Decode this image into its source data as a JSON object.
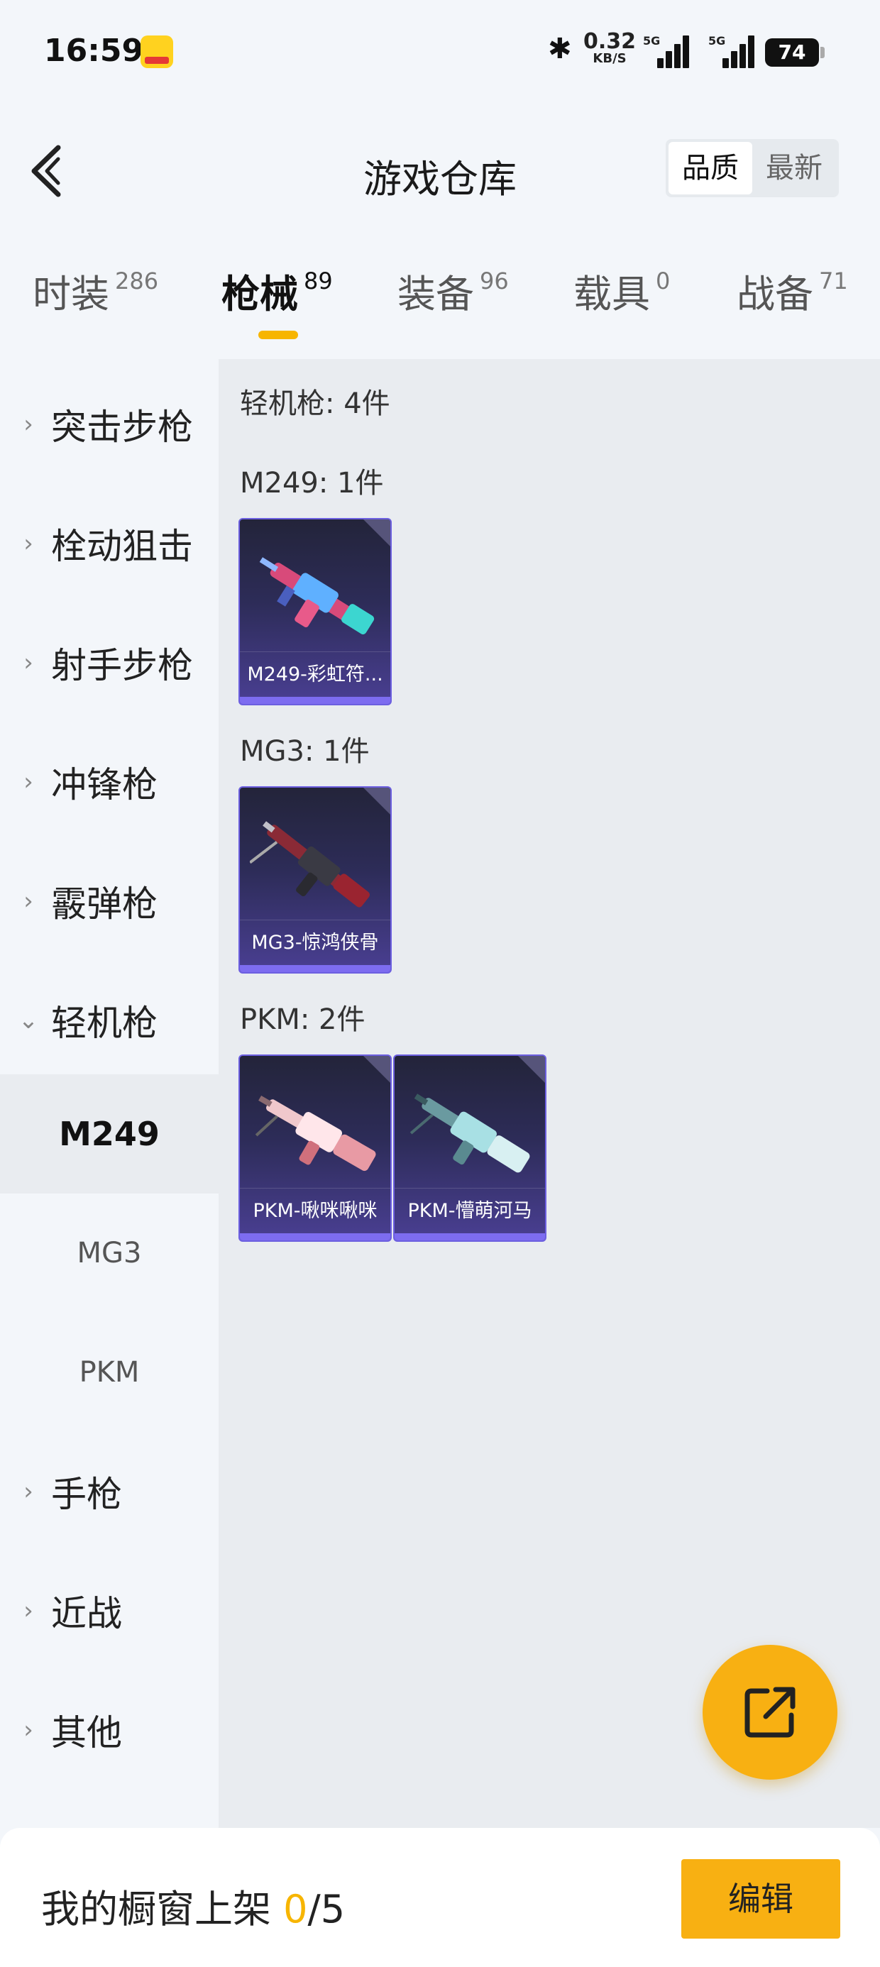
{
  "status_bar": {
    "time": "16:59",
    "net_speed_value": "0.32",
    "net_speed_unit": "KB/S",
    "signal1_label": "5G",
    "signal2_label": "5G",
    "battery": "74"
  },
  "header": {
    "title": "游戏仓库",
    "sort_options": [
      "品质",
      "最新"
    ],
    "active_sort": "品质"
  },
  "tabs": [
    {
      "label": "时装",
      "count": "286"
    },
    {
      "label": "枪械",
      "count": "89"
    },
    {
      "label": "装备",
      "count": "96"
    },
    {
      "label": "载具",
      "count": "0"
    },
    {
      "label": "战备",
      "count": "71"
    }
  ],
  "active_tab": "枪械",
  "sidebar": {
    "categories": [
      {
        "label": "突击步枪",
        "chevron": "›"
      },
      {
        "label": "栓动狙击",
        "chevron": "›"
      },
      {
        "label": "射手步枪",
        "chevron": "›"
      },
      {
        "label": "冲锋枪",
        "chevron": "›"
      },
      {
        "label": "霰弹枪",
        "chevron": "›"
      },
      {
        "label": "轻机枪",
        "chevron": "⌄"
      }
    ],
    "subitems": [
      "M249",
      "MG3",
      "PKM"
    ],
    "active_subitem": "M249",
    "more_categories": [
      {
        "label": "手枪",
        "chevron": "›"
      },
      {
        "label": "近战",
        "chevron": "›"
      },
      {
        "label": "其他",
        "chevron": "›"
      }
    ]
  },
  "main": {
    "category_summary": "轻机枪: 4件",
    "groups": [
      {
        "title": "M249: 1件",
        "items": [
          {
            "name": "M249-彩虹符..."
          }
        ]
      },
      {
        "title": "MG3: 1件",
        "items": [
          {
            "name": "MG3-惊鸿侠骨"
          }
        ]
      },
      {
        "title": "PKM: 2件",
        "items": [
          {
            "name": "PKM-啾咪啾咪"
          },
          {
            "name": "PKM-懵萌河马"
          }
        ]
      }
    ]
  },
  "bottom_bar": {
    "label": "我的橱窗上架",
    "count": "0",
    "total": "/5",
    "edit_label": "编辑"
  },
  "colors": {
    "accent": "#f8b012",
    "card_border": "#6c5fe0",
    "card_bottom": "#7d6cf0"
  }
}
